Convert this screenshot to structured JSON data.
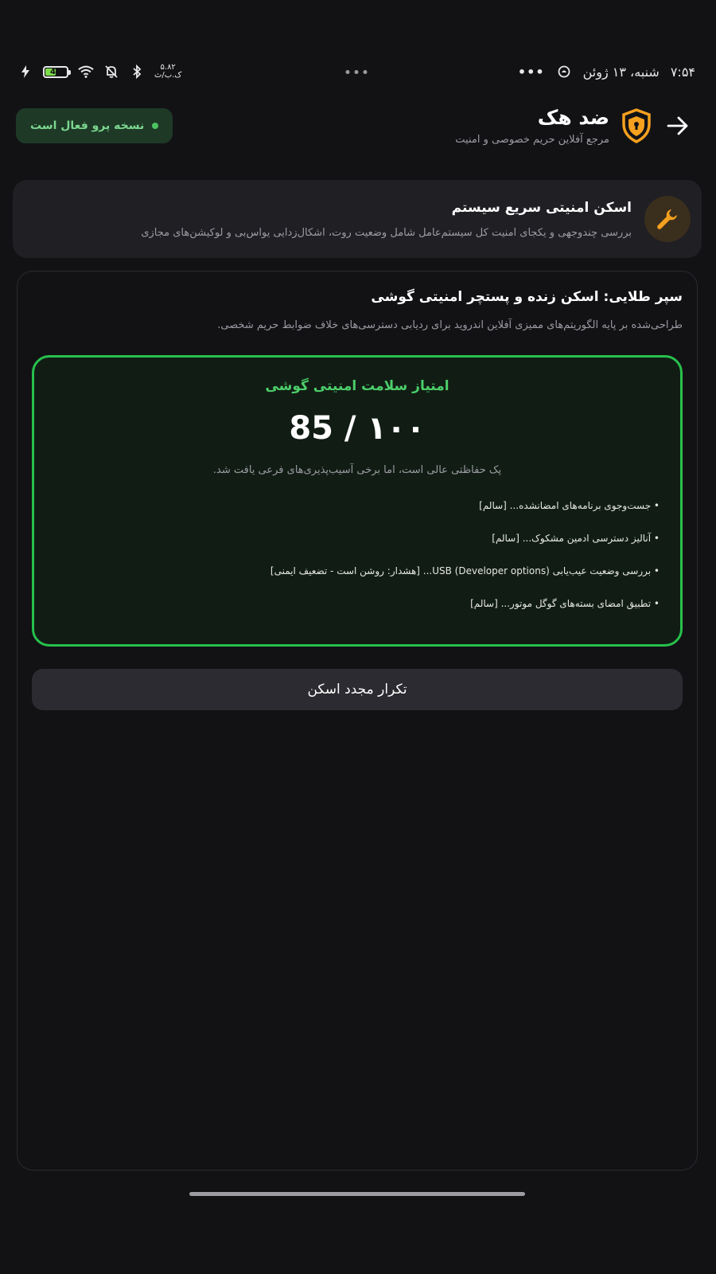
{
  "status_bar": {
    "time": "۷:۵۴",
    "date": "شنبه، ۱۳ ژوئن",
    "battery": "46",
    "net_speed_value": "۵.۸۲",
    "net_speed_unit": "ک.ب/ث"
  },
  "header": {
    "title": "ضد هک",
    "subtitle": "مرجع آفلاین حریم خصوصی و امنیت",
    "pro_badge": "نسخه پرو فعال است"
  },
  "quick_scan": {
    "title": "اسکن امنیتی سریع سیستم",
    "description": "بررسی چندوجهی و یکجای امنیت کل سیستم‌عامل شامل وضعیت روت، اشکال‌زدایی یواس‌بی و لوکیشن‌های مجازی"
  },
  "main": {
    "title": "سپر طلایی: اسکن زنده و پستچر امنیتی گوشی",
    "description": "طراحی‌شده بر پایه الگوریتم‌های ممیزی آفلاین اندروید برای ردیابی دسترسی‌های خلاف ضوابط حریم شخصی.",
    "score": {
      "title": "امتیاز سلامت امنیتی گوشی",
      "value": "85 / ۱۰۰",
      "note": "پک حفاظتی عالی است، اما برخی آسیب‌پذیری‌های فرعی یافت شد."
    },
    "checks": [
      "• جست‌وجوی برنامه‌های امضانشده... [سالم]",
      "• آنالیز دسترسی ادمین مشکوک... [سالم]",
      "• بررسی وضعیت عیب‌یابی USB (Developer options)... [هشدار: روشن است - تضعیف ایمنی]",
      "• تطبیق امضای بسته‌های گوگل موتور... [سالم]"
    ],
    "rescan_label": "تکرار مجدد اسکن"
  },
  "colors": {
    "accent_orange": "#f5a01e",
    "accent_green": "#27c04c",
    "background": "#121215"
  }
}
